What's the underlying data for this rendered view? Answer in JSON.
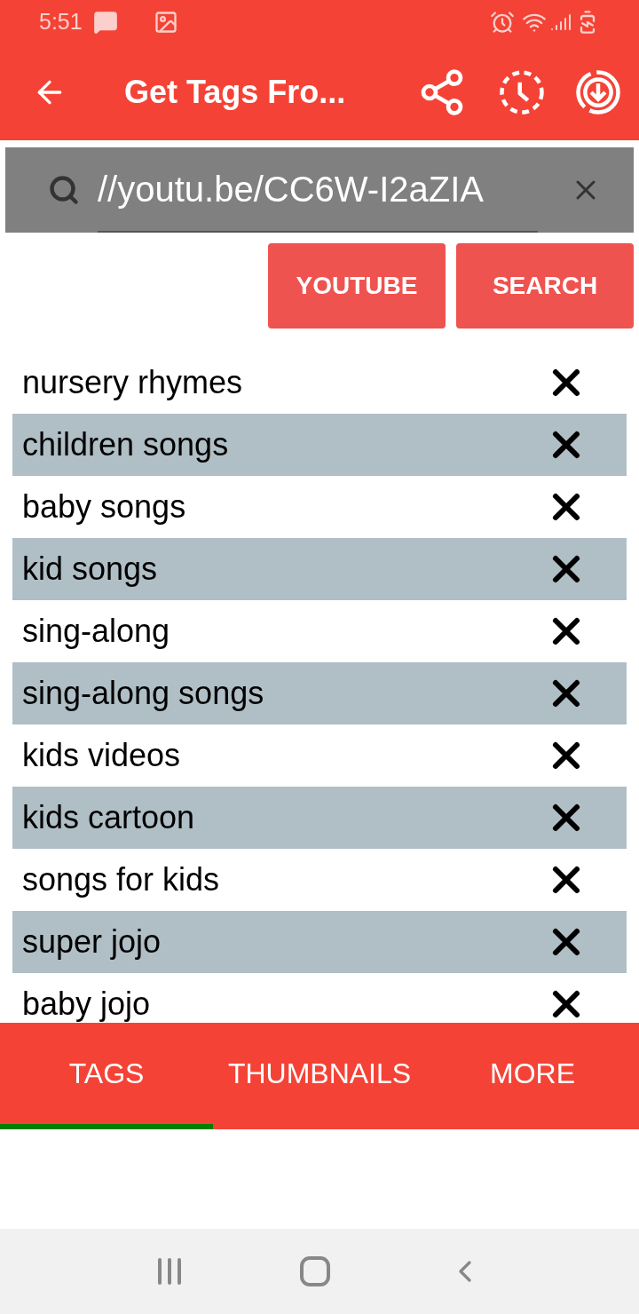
{
  "status_bar": {
    "time": "5:51"
  },
  "app_bar": {
    "title": "Get Tags Fro..."
  },
  "search": {
    "value": "//youtu.be/CC6W-I2aZIA"
  },
  "buttons": [
    "YOUTUBE",
    "SEARCH"
  ],
  "tags": [
    "nursery rhymes",
    "children songs",
    "baby songs",
    "kid songs",
    "sing-along",
    "sing-along songs",
    "kids videos",
    "kids cartoon",
    "songs for kids",
    "super jojo",
    "baby jojo"
  ],
  "tabs": [
    {
      "label": "TAGS",
      "selected": true
    },
    {
      "label": "THUMBNAILS",
      "selected": false
    },
    {
      "label": "MORE",
      "selected": false
    }
  ]
}
